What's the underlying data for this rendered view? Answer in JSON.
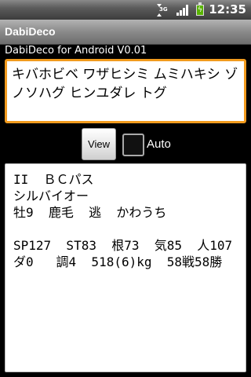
{
  "status_bar": {
    "network_type": "3G",
    "time": "12:35",
    "icons": [
      "3g-data-icon",
      "signal-strength-icon",
      "battery-charging-icon"
    ]
  },
  "app": {
    "title": "DabiDeco",
    "version_text": "DabiDeco for Android V0.01"
  },
  "input": {
    "value": "キバホビベ ワザヒシミ ムミハキシ ゾノソハグ ヒンユダレ トグ"
  },
  "controls": {
    "view_label": "View",
    "auto_label": "Auto",
    "auto_checked": false
  },
  "result": {
    "lines": [
      "II  ＢＣパス",
      "シルバイオー",
      "牡9  鹿毛  逃  かわうち",
      "",
      "SP127  ST83  根73  気85  人107",
      "ダ0   調4  518(6)kg  58戦58勝"
    ]
  },
  "colors": {
    "input_border": "#f29b1e",
    "battery": "#59b300",
    "background": "#000000"
  }
}
